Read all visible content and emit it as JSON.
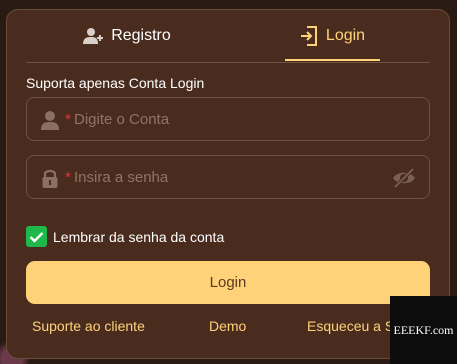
{
  "tabs": {
    "register_label": "Registro",
    "login_label": "Login",
    "active": "Login"
  },
  "form": {
    "hint": "Suporta apenas Conta Login",
    "account": {
      "required_mark": "*",
      "placeholder": "Digite o Conta",
      "value": ""
    },
    "password": {
      "required_mark": "*",
      "placeholder": "Insira a senha",
      "value": ""
    },
    "remember": {
      "label": "Lembrar da senha da conta",
      "checked": true
    },
    "submit_label": "Login"
  },
  "footer": {
    "support_label": "Suporte ao cliente",
    "demo_label": "Demo",
    "forgot_label": "Esqueceu a S"
  },
  "watermark": {
    "text": "EEEKF.com"
  },
  "icons": {
    "register": "user-plus-icon",
    "login": "login-door-icon",
    "account": "user-icon",
    "password": "lock-icon",
    "visibility": "eye-slash-icon",
    "checkbox": "check-icon"
  },
  "colors": {
    "panel": "#4a2c1f",
    "accent": "#ffd27a",
    "required": "#e0343a",
    "checkbox": "#1fb84a",
    "text": "#ffffff"
  }
}
